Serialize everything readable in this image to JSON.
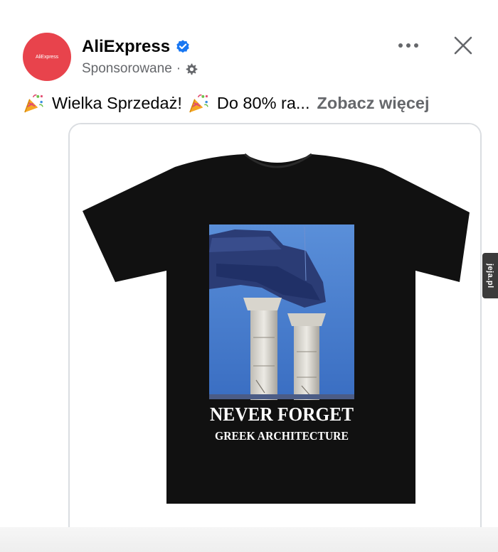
{
  "post": {
    "page_name": "AliExpress",
    "avatar_text": "AliExpress",
    "sponsored_label": "Sponsorowane",
    "meta_separator": "·",
    "caption": {
      "part1": "Wielka Sprzedaż!",
      "part2": "Do 80% ra...",
      "see_more": "Zobacz więcej"
    }
  },
  "product": {
    "print_headline": "NEVER FORGET",
    "print_subline": "GREEK ARCHITECTURE"
  },
  "watermark": {
    "text": "jeja.pl"
  },
  "colors": {
    "brand": "#e8434c",
    "verified": "#1877f2",
    "muted_text": "#65676b",
    "shirt": "#111111",
    "sky": "#3f74c6"
  },
  "icons": [
    "verified-badge-icon",
    "gear-icon",
    "more-options-icon",
    "close-icon",
    "party-popper-icon"
  ]
}
